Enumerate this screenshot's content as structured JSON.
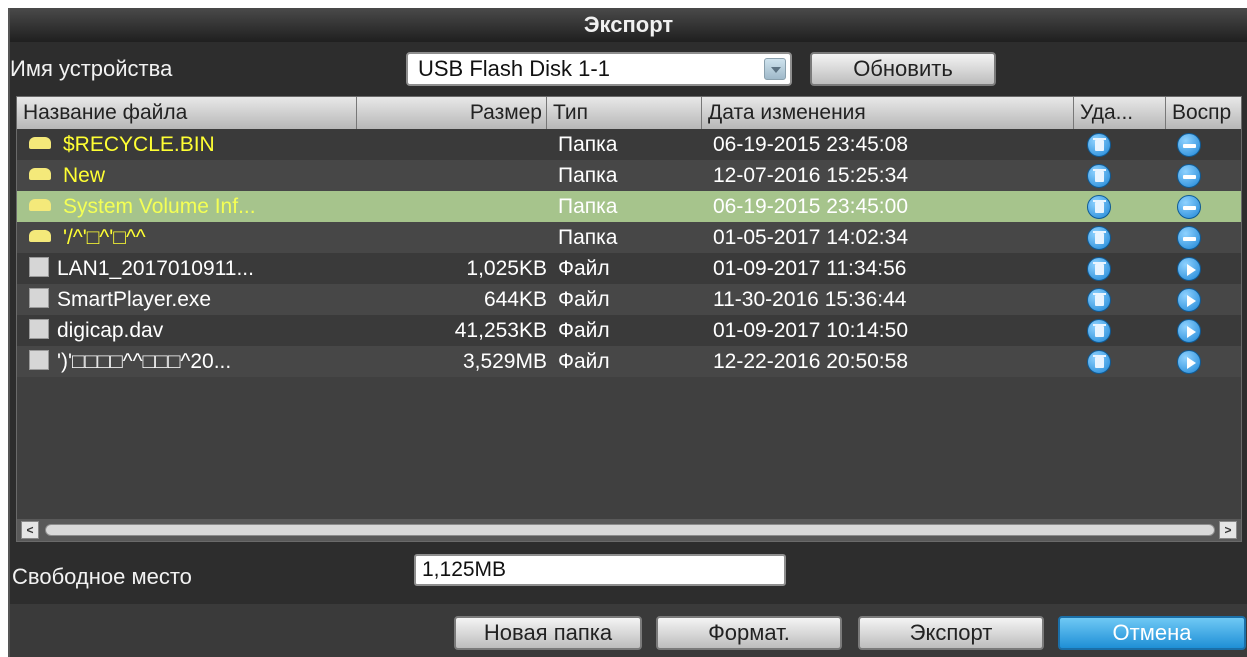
{
  "dialog": {
    "title": "Экспорт"
  },
  "device": {
    "label": "Имя устройства",
    "selected": "USB Flash Disk 1-1",
    "refresh_label": "Обновить"
  },
  "table": {
    "columns": {
      "name": "Название файла",
      "size": "Размер",
      "type": "Тип",
      "date": "Дата изменения",
      "delete": "Уда...",
      "play": "Воспр"
    },
    "rows": [
      {
        "name": "$RECYCLE.BIN",
        "size": "",
        "type": "Папка",
        "date": "06-19-2015 23:45:08",
        "kind": "folder"
      },
      {
        "name": "New",
        "size": "",
        "type": "Папка",
        "date": "12-07-2016 15:25:34",
        "kind": "folder"
      },
      {
        "name": "System Volume Inf...",
        "size": "",
        "type": "Папка",
        "date": "06-19-2015 23:45:00",
        "kind": "folder",
        "selected": true
      },
      {
        "name": "'/^'□^'□^^",
        "size": "",
        "type": "Папка",
        "date": "01-05-2017 14:02:34",
        "kind": "folder"
      },
      {
        "name": "LAN1_2017010911...",
        "size": "1,025KB",
        "type": "Файл",
        "date": "01-09-2017 11:34:56",
        "kind": "file"
      },
      {
        "name": "SmartPlayer.exe",
        "size": "644KB",
        "type": "Файл",
        "date": "11-30-2016 15:36:44",
        "kind": "file"
      },
      {
        "name": "digicap.dav",
        "size": "41,253KB",
        "type": "Файл",
        "date": "01-09-2017 10:14:50",
        "kind": "file"
      },
      {
        "name": "')'□□□□^^□□□^20...",
        "size": "3,529MB",
        "type": "Файл",
        "date": "12-22-2016 20:50:58",
        "kind": "file"
      }
    ]
  },
  "free_space": {
    "label": "Свободное место",
    "value": "1,125MB"
  },
  "buttons": {
    "new_folder": "Новая папка",
    "format": "Формат.",
    "export": "Экспорт",
    "cancel": "Отмена"
  },
  "colors": {
    "folder_text": "#ffff33",
    "selected_row": "#a6c48c",
    "accent": "#1f8fd6"
  },
  "icons": {
    "delete": "trash-icon",
    "play_folder": "open-folder-icon",
    "play_file": "play-icon"
  }
}
